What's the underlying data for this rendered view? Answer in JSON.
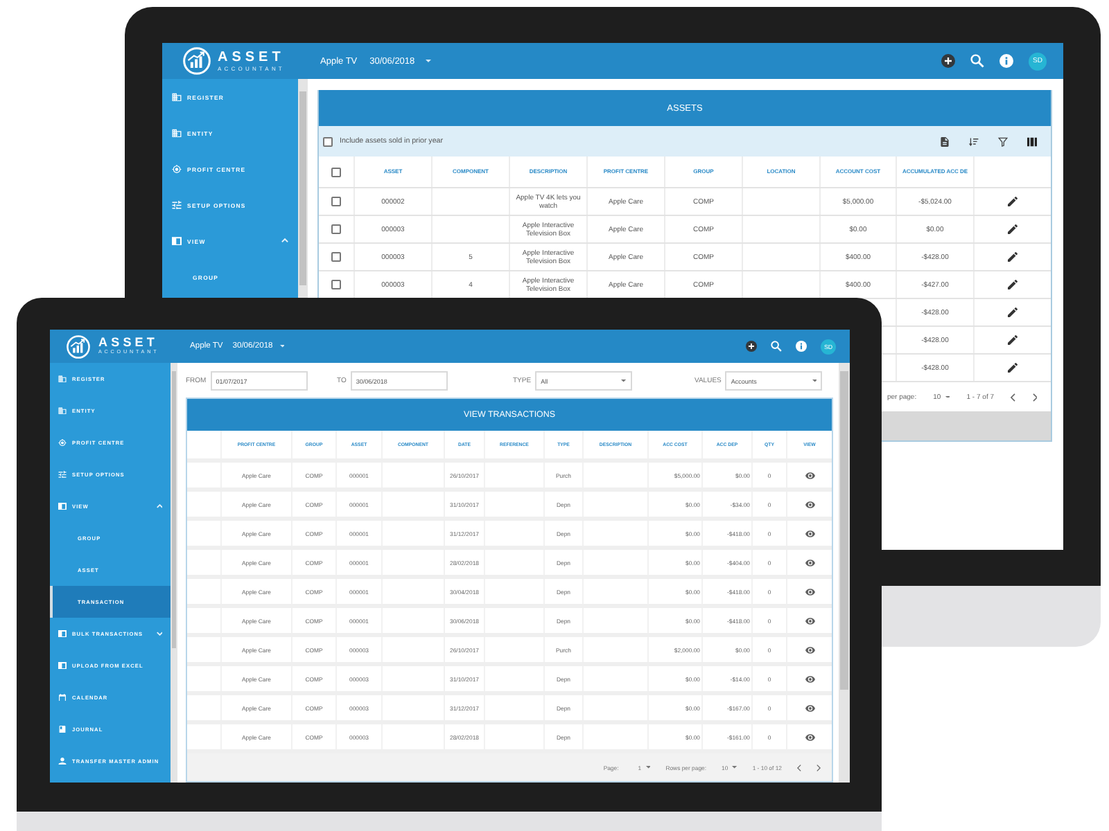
{
  "back_monitor": {
    "app_bar": {
      "logo_title": "ASSET",
      "logo_subtitle": "ACCOUNTANT",
      "company": "Apple TV",
      "date": "30/06/2018",
      "avatar": "SD"
    },
    "sidebar": {
      "items": [
        {
          "label": "REGISTER",
          "selected": false
        },
        {
          "label": "ENTITY",
          "selected": false
        },
        {
          "label": "PROFIT CENTRE",
          "selected": false
        },
        {
          "label": "SETUP OPTIONS",
          "selected": false
        },
        {
          "label": "VIEW",
          "selected": false,
          "expanded": true,
          "children": [
            {
              "label": "GROUP",
              "selected": false
            }
          ]
        }
      ]
    },
    "assets_card": {
      "title": "ASSETS",
      "include_sold": {
        "label": "Include assets sold in prior year",
        "checked": false
      },
      "select_all_checked": false,
      "columns": [
        "ASSET",
        "COMPONENT",
        "DESCRIPTION",
        "PROFIT CENTRE",
        "GROUP",
        "LOCATION",
        "ACCOUNT COST",
        "ACCUMULATED ACC DE"
      ],
      "rows": [
        {
          "checked": false,
          "cells": [
            "000002",
            null,
            "Apple TV 4K lets you watch",
            "Apple Care",
            "COMP",
            null,
            "$5,000.00",
            "-$5,024.00"
          ]
        },
        {
          "checked": false,
          "cells": [
            "000003",
            null,
            "Apple Interactive Television Box",
            "Apple Care",
            "COMP",
            null,
            "$0.00",
            "$0.00"
          ]
        },
        {
          "checked": false,
          "cells": [
            "000003",
            "5",
            "Apple Interactive Television Box",
            "Apple Care",
            "COMP",
            null,
            "$400.00",
            "-$428.00"
          ]
        },
        {
          "checked": false,
          "cells": [
            "000003",
            "4",
            "Apple Interactive Television Box",
            "Apple Care",
            "COMP",
            null,
            "$400.00",
            "-$427.00"
          ]
        },
        {
          "cells": [
            null,
            null,
            null,
            null,
            null,
            null,
            null,
            "-$428.00"
          ]
        },
        {
          "cells": [
            null,
            null,
            null,
            null,
            null,
            null,
            null,
            "-$428.00"
          ]
        },
        {
          "cells": [
            null,
            null,
            null,
            null,
            null,
            null,
            null,
            "-$428.00"
          ]
        }
      ],
      "pagination": {
        "rows_per_page_label": "per page:",
        "rows_per_page": "10",
        "range": "1 - 7 of 7"
      }
    }
  },
  "front_monitor": {
    "app_bar": {
      "logo_title": "ASSET",
      "logo_subtitle": "ACCOUNTANT",
      "company": "Apple TV",
      "date": "30/06/2018",
      "avatar": "SD"
    },
    "sidebar": {
      "items": [
        {
          "label": "REGISTER",
          "selected": false
        },
        {
          "label": "ENTITY",
          "selected": false
        },
        {
          "label": "PROFIT CENTRE",
          "selected": false
        },
        {
          "label": "SETUP OPTIONS",
          "selected": false
        },
        {
          "label": "VIEW",
          "selected": false,
          "expanded": true,
          "children": [
            {
              "label": "GROUP",
              "selected": false
            },
            {
              "label": "ASSET",
              "selected": false
            },
            {
              "label": "TRANSACTION",
              "selected": true
            }
          ]
        },
        {
          "label": "BULK TRANSACTIONS",
          "selected": false,
          "expanded": false
        },
        {
          "label": "UPLOAD FROM EXCEL",
          "selected": false
        },
        {
          "label": "CALENDAR",
          "selected": false
        },
        {
          "label": "JOURNAL",
          "selected": false
        },
        {
          "label": "TRANSFER MASTER ADMIN",
          "selected": false
        }
      ]
    },
    "filters": [
      {
        "label": "FROM",
        "kind": "date",
        "value": "01/07/2017"
      },
      {
        "label": "TO",
        "kind": "date",
        "value": "30/06/2018"
      },
      {
        "label": "TYPE",
        "kind": "select",
        "value": "All"
      },
      {
        "label": "VALUES",
        "kind": "select",
        "value": "Accounts"
      }
    ],
    "transactions_card": {
      "title": "VIEW TRANSACTIONS",
      "columns": [
        "PROFIT CENTRE",
        "GROUP",
        "ASSET",
        "COMPONENT",
        "DATE",
        "REFERENCE",
        "TYPE",
        "DESCRIPTION",
        "ACC COST",
        "ACC DEP",
        "QTY",
        "VIEW"
      ],
      "rows": [
        {
          "cells": [
            "Apple Care",
            "COMP",
            "000001",
            null,
            "26/10/2017",
            null,
            "Purch",
            null,
            "$5,000.00",
            "$0.00",
            "0"
          ]
        },
        {
          "cells": [
            "Apple Care",
            "COMP",
            "000001",
            null,
            "31/10/2017",
            null,
            "Depn",
            null,
            "$0.00",
            "-$34.00",
            "0"
          ]
        },
        {
          "cells": [
            "Apple Care",
            "COMP",
            "000001",
            null,
            "31/12/2017",
            null,
            "Depn",
            null,
            "$0.00",
            "-$418.00",
            "0"
          ]
        },
        {
          "cells": [
            "Apple Care",
            "COMP",
            "000001",
            null,
            "28/02/2018",
            null,
            "Depn",
            null,
            "$0.00",
            "-$404.00",
            "0"
          ]
        },
        {
          "cells": [
            "Apple Care",
            "COMP",
            "000001",
            null,
            "30/04/2018",
            null,
            "Depn",
            null,
            "$0.00",
            "-$418.00",
            "0"
          ]
        },
        {
          "cells": [
            "Apple Care",
            "COMP",
            "000001",
            null,
            "30/06/2018",
            null,
            "Depn",
            null,
            "$0.00",
            "-$418.00",
            "0"
          ]
        },
        {
          "cells": [
            "Apple Care",
            "COMP",
            "000003",
            null,
            "26/10/2017",
            null,
            "Purch",
            null,
            "$2,000.00",
            "$0.00",
            "0"
          ]
        },
        {
          "cells": [
            "Apple Care",
            "COMP",
            "000003",
            null,
            "31/10/2017",
            null,
            "Depn",
            null,
            "$0.00",
            "-$14.00",
            "0"
          ]
        },
        {
          "cells": [
            "Apple Care",
            "COMP",
            "000003",
            null,
            "31/12/2017",
            null,
            "Depn",
            null,
            "$0.00",
            "-$167.00",
            "0"
          ]
        },
        {
          "cells": [
            "Apple Care",
            "COMP",
            "000003",
            null,
            "28/02/2018",
            null,
            "Depn",
            null,
            "$0.00",
            "-$161.00",
            "0"
          ]
        }
      ],
      "pagination": {
        "page_label": "Page:",
        "page": "1",
        "rows_per_page_label": "Rows per page:",
        "rows_per_page": "10",
        "range": "1 - 10 of 12"
      }
    }
  }
}
